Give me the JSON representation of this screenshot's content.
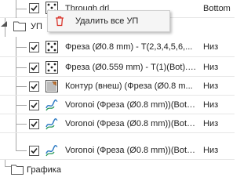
{
  "tree": {
    "top_row": {
      "label": "Through drl",
      "side": "Bottom",
      "checked": true,
      "icon": "drill-holes-icon"
    },
    "folder_up": {
      "label": "УП",
      "icon": "folder-icon",
      "expanded": true
    },
    "operations": [
      {
        "label": "Фреза (Ø0.8 mm) - T(2,3,4,5,6,...",
        "side": "Низ",
        "checked": true,
        "icon": "drill-holes-icon"
      },
      {
        "label": "Фреза (Ø0.559 mm) - T(1)(Bot).t...",
        "side": "Низ",
        "checked": true,
        "icon": "drill-holes-icon"
      },
      {
        "label": "Контур (внеш) (Фреза (Ø0.8 m...",
        "side": "Низ",
        "checked": true,
        "icon": "contour-icon"
      },
      {
        "label": "Voronoi (Фреза (Ø0.8 mm))(Bot)....",
        "side": "Низ",
        "checked": true,
        "icon": "voronoi-icon"
      },
      {
        "label": "Voronoi (Фреза (Ø0.8 mm))(Bot)....",
        "side": "Низ",
        "checked": true,
        "icon": "voronoi-icon"
      },
      {
        "label": "Voronoi (Фреза (Ø0.8 mm))(Bot)....",
        "side": "Низ",
        "checked": true,
        "icon": "voronoi-icon"
      }
    ],
    "folder_graphics": {
      "label": "Графика",
      "icon": "folder-icon"
    }
  },
  "context_menu": {
    "items": [
      {
        "label": "Удалить все УП",
        "icon": "trash-icon"
      }
    ]
  },
  "colors": {
    "tree_line": "#a6a6a6",
    "trash_red": "#d9342b",
    "voronoi_blue": "#2e7bc4",
    "voronoi_green": "#2a9a5a"
  }
}
